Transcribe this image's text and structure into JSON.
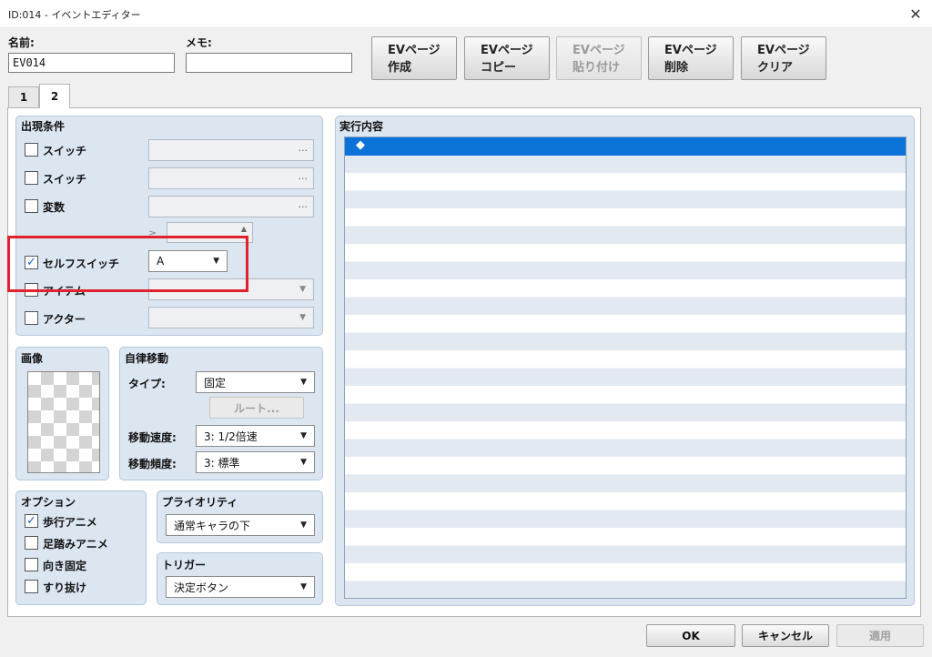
{
  "window": {
    "title": "ID:014 - イベントエディター",
    "close_glyph": "✕"
  },
  "header": {
    "name_label": "名前:",
    "name_value": "EV014",
    "memo_label": "メモ:",
    "memo_value": ""
  },
  "page_buttons": [
    {
      "line1": "EVページ",
      "line2": "作成",
      "enabled": true
    },
    {
      "line1": "EVページ",
      "line2": "コピー",
      "enabled": true
    },
    {
      "line1": "EVページ",
      "line2": "貼り付け",
      "enabled": false
    },
    {
      "line1": "EVページ",
      "line2": "削除",
      "enabled": true
    },
    {
      "line1": "EVページ",
      "line2": "クリア",
      "enabled": true
    }
  ],
  "tabs": [
    {
      "label": "1",
      "active": false
    },
    {
      "label": "2",
      "active": true
    }
  ],
  "conditions": {
    "title": "出現条件",
    "switch1": {
      "label": "スイッチ",
      "checked": false,
      "picker": "···"
    },
    "switch2": {
      "label": "スイッチ",
      "checked": false,
      "picker": "···"
    },
    "variable": {
      "label": "変数",
      "checked": false,
      "picker": "···",
      "operator": "≥"
    },
    "self_switch": {
      "label": "セルフスイッチ",
      "checked": true,
      "value": "A"
    },
    "item": {
      "label": "アイテム",
      "checked": false,
      "value": ""
    },
    "actor": {
      "label": "アクター",
      "checked": false,
      "value": ""
    }
  },
  "image": {
    "title": "画像"
  },
  "autonomous": {
    "title": "自律移動",
    "type_label": "タイプ:",
    "type_value": "固定",
    "route_button": "ルート...",
    "speed_label": "移動速度:",
    "speed_value": "3: 1/2倍速",
    "freq_label": "移動頻度:",
    "freq_value": "3: 標準"
  },
  "options": {
    "title": "オプション",
    "items": [
      {
        "label": "歩行アニメ",
        "checked": true
      },
      {
        "label": "足踏みアニメ",
        "checked": false
      },
      {
        "label": "向き固定",
        "checked": false
      },
      {
        "label": "すり抜け",
        "checked": false
      }
    ]
  },
  "priority": {
    "title": "プライオリティ",
    "value": "通常キャラの下"
  },
  "trigger": {
    "title": "トリガー",
    "value": "決定ボタン"
  },
  "contents": {
    "title": "実行内容",
    "rows": [
      "◆"
    ]
  },
  "footer": {
    "ok": "OK",
    "cancel": "キャンセル",
    "apply": "適用"
  },
  "colors": {
    "highlight": "#e3202e",
    "selection": "#0b73d8",
    "group_bg": "#dce6f1",
    "check": "#2563c9"
  }
}
